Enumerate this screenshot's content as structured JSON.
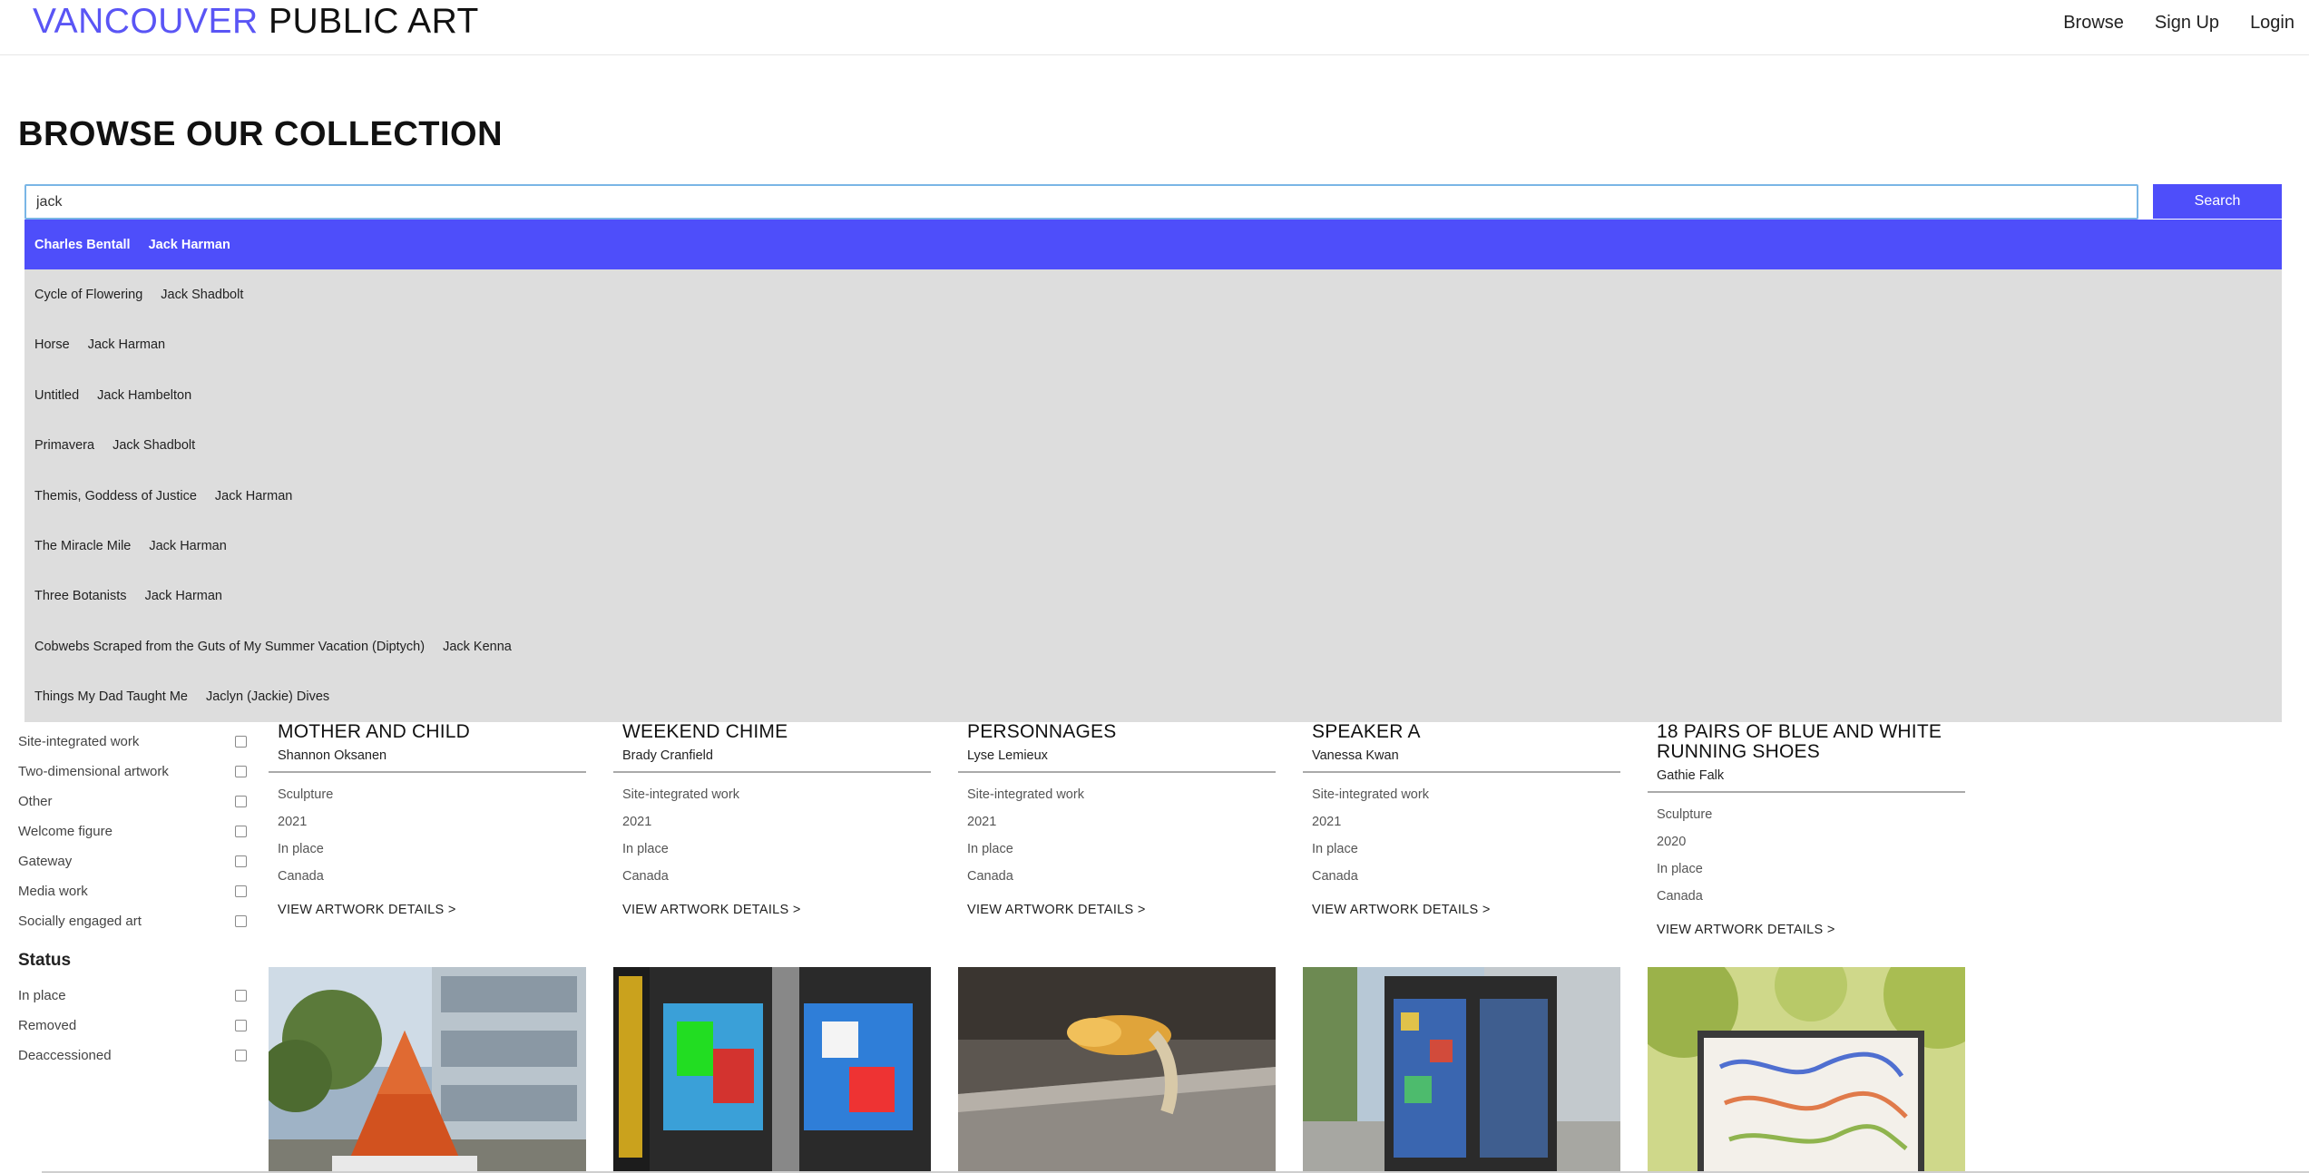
{
  "header": {
    "brand_accent": "VANCOUVER",
    "brand_rest": "PUBLIC ART",
    "nav": {
      "browse": "Browse",
      "signup": "Sign Up",
      "login": "Login"
    }
  },
  "page_title": "BROWSE OUR COLLECTION",
  "search": {
    "value": "jack",
    "button": "Search"
  },
  "suggestions": [
    {
      "title": "Charles Bentall",
      "artist": "Jack Harman"
    },
    {
      "title": "Cycle of Flowering",
      "artist": "Jack Shadbolt"
    },
    {
      "title": "Horse",
      "artist": "Jack Harman"
    },
    {
      "title": "Untitled",
      "artist": "Jack Hambelton"
    },
    {
      "title": "Primavera",
      "artist": "Jack Shadbolt"
    },
    {
      "title": "Themis, Goddess of Justice",
      "artist": "Jack Harman"
    },
    {
      "title": "The Miracle Mile",
      "artist": "Jack Harman"
    },
    {
      "title": "Three Botanists",
      "artist": "Jack Harman"
    },
    {
      "title": "Cobwebs Scraped from the Guts of My Summer Vacation (Diptych)",
      "artist": "Jack Kenna"
    },
    {
      "title": "Things My Dad Taught Me",
      "artist": "Jaclyn (Jackie) Dives"
    }
  ],
  "sidebar": {
    "type_items": [
      "Site-integrated work",
      "Two-dimensional artwork",
      "Other",
      "Welcome figure",
      "Gateway",
      "Media work",
      "Socially engaged art"
    ],
    "status_heading": "Status",
    "status_items": [
      "In place",
      "Removed",
      "Deaccessioned"
    ]
  },
  "cards": [
    {
      "title": "MOTHER AND CHILD",
      "artist": "Shannon Oksanen",
      "type": "Sculpture",
      "year": "2021",
      "status": "In place",
      "country": "Canada",
      "link": "VIEW ARTWORK DETAILS >"
    },
    {
      "title": "WEEKEND CHIME",
      "artist": "Brady Cranfield",
      "type": "Site-integrated work",
      "year": "2021",
      "status": "In place",
      "country": "Canada",
      "link": "VIEW ARTWORK DETAILS >"
    },
    {
      "title": "PERSONNAGES",
      "artist": "Lyse Lemieux",
      "type": "Site-integrated work",
      "year": "2021",
      "status": "In place",
      "country": "Canada",
      "link": "VIEW ARTWORK DETAILS >"
    },
    {
      "title": "SPEAKER A",
      "artist": "Vanessa Kwan",
      "type": "Site-integrated work",
      "year": "2021",
      "status": "In place",
      "country": "Canada",
      "link": "VIEW ARTWORK DETAILS >"
    },
    {
      "title": "18 PAIRS OF BLUE AND WHITE RUNNING SHOES",
      "artist": "Gathie Falk",
      "type": "Sculpture",
      "year": "2020",
      "status": "In place",
      "country": "Canada",
      "link": "VIEW ARTWORK DETAILS >"
    }
  ],
  "colors": {
    "accent": "#4e4efa",
    "brand_accent": "#5a55f5",
    "dropdown_bg": "#dddddd"
  }
}
